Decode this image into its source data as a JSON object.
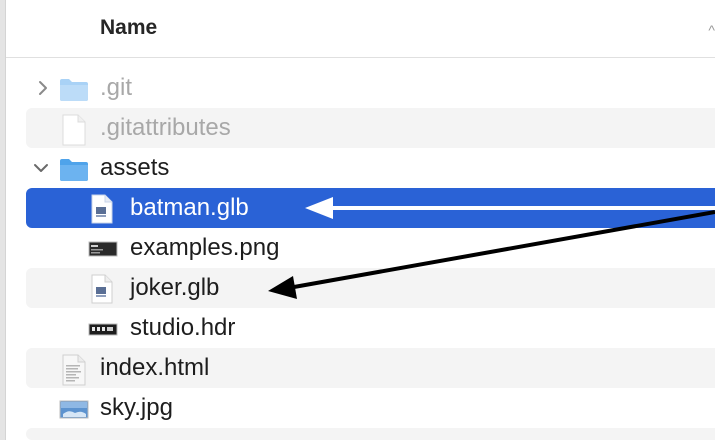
{
  "header": {
    "name_column": "Name",
    "sort_indicator": "^"
  },
  "files": [
    {
      "name": ".git",
      "kind": "folder",
      "icon": "folder-icon",
      "expanded": false,
      "dimmed": true
    },
    {
      "name": ".gitattributes",
      "kind": "file",
      "icon": "blank-document-icon",
      "dimmed": true
    },
    {
      "name": "assets",
      "kind": "folder",
      "icon": "folder-icon",
      "expanded": true
    },
    {
      "name": "batman.glb",
      "kind": "file",
      "icon": "glb-document-icon",
      "selected": true
    },
    {
      "name": "examples.png",
      "kind": "file",
      "icon": "png-image-thumbnail-icon"
    },
    {
      "name": "joker.glb",
      "kind": "file",
      "icon": "glb-document-icon"
    },
    {
      "name": "studio.hdr",
      "kind": "file",
      "icon": "hdr-image-thumbnail-icon"
    },
    {
      "name": "index.html",
      "kind": "file",
      "icon": "html-document-icon"
    },
    {
      "name": "sky.jpg",
      "kind": "file",
      "icon": "jpg-image-thumbnail-icon"
    }
  ],
  "colors": {
    "selection": "#2a62d6",
    "folder": "#6cb3f0",
    "annotation_white_arrow": "#ffffff",
    "annotation_black_arrow": "#000000"
  }
}
